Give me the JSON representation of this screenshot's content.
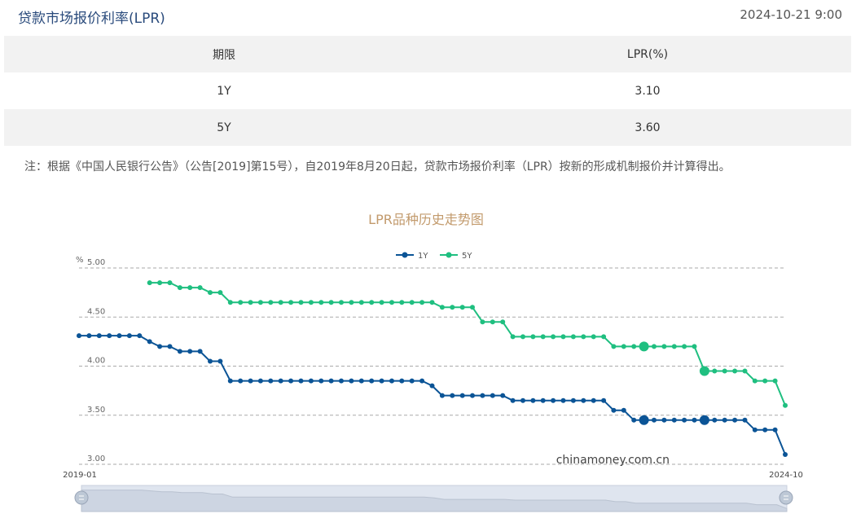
{
  "header": {
    "title": "贷款市场报价利率(LPR)",
    "timestamp": "2024-10-21 9:00"
  },
  "table": {
    "headers": [
      "期限",
      "LPR(%)"
    ],
    "rows": [
      {
        "term": "1Y",
        "rate": "3.10"
      },
      {
        "term": "5Y",
        "rate": "3.60"
      }
    ]
  },
  "note": "注：根据《中国人民银行公告》（公告[2019]第15号），自2019年8月20日起，贷款市场报价利率（LPR）按新的形成机制报价并计算得出。",
  "watermark": "chinamoney.com.cn",
  "slider": {
    "start_label": "2019-01",
    "end_label": "2024-10"
  },
  "colors": {
    "series_1y": "#0b5496",
    "series_5y": "#1fbf80",
    "title": "#c29a6c",
    "grid": "#aaaaaa"
  },
  "chart_data": {
    "type": "line",
    "title": "LPR品种历史走势图",
    "ylabel": "%",
    "ylim": [
      3.0,
      5.0
    ],
    "y_ticks": [
      "5.00",
      "4.50",
      "4.00",
      "3.50",
      "3.00"
    ],
    "x_start": "2019-01",
    "x_end": "2024-10",
    "legend_position": "top-center",
    "grid": true,
    "series": [
      {
        "name": "1Y",
        "values": [
          4.31,
          4.31,
          4.31,
          4.31,
          4.31,
          4.31,
          4.31,
          4.25,
          4.2,
          4.2,
          4.15,
          4.15,
          4.15,
          4.05,
          4.05,
          3.85,
          3.85,
          3.85,
          3.85,
          3.85,
          3.85,
          3.85,
          3.85,
          3.85,
          3.85,
          3.85,
          3.85,
          3.85,
          3.85,
          3.85,
          3.85,
          3.85,
          3.85,
          3.85,
          3.85,
          3.8,
          3.7,
          3.7,
          3.7,
          3.7,
          3.7,
          3.7,
          3.7,
          3.65,
          3.65,
          3.65,
          3.65,
          3.65,
          3.65,
          3.65,
          3.65,
          3.65,
          3.65,
          3.55,
          3.55,
          3.45,
          3.45,
          3.45,
          3.45,
          3.45,
          3.45,
          3.45,
          3.45,
          3.45,
          3.45,
          3.45,
          3.45,
          3.35,
          3.35,
          3.35,
          3.1
        ],
        "highlight_indexes": [
          56,
          62
        ]
      },
      {
        "name": "5Y",
        "values": [
          null,
          null,
          null,
          null,
          null,
          null,
          null,
          4.85,
          4.85,
          4.85,
          4.8,
          4.8,
          4.8,
          4.75,
          4.75,
          4.65,
          4.65,
          4.65,
          4.65,
          4.65,
          4.65,
          4.65,
          4.65,
          4.65,
          4.65,
          4.65,
          4.65,
          4.65,
          4.65,
          4.65,
          4.65,
          4.65,
          4.65,
          4.65,
          4.65,
          4.65,
          4.6,
          4.6,
          4.6,
          4.6,
          4.45,
          4.45,
          4.45,
          4.3,
          4.3,
          4.3,
          4.3,
          4.3,
          4.3,
          4.3,
          4.3,
          4.3,
          4.3,
          4.2,
          4.2,
          4.2,
          4.2,
          4.2,
          4.2,
          4.2,
          4.2,
          4.2,
          3.95,
          3.95,
          3.95,
          3.95,
          3.95,
          3.85,
          3.85,
          3.85,
          3.6
        ],
        "highlight_indexes": [
          56,
          62
        ]
      }
    ]
  }
}
